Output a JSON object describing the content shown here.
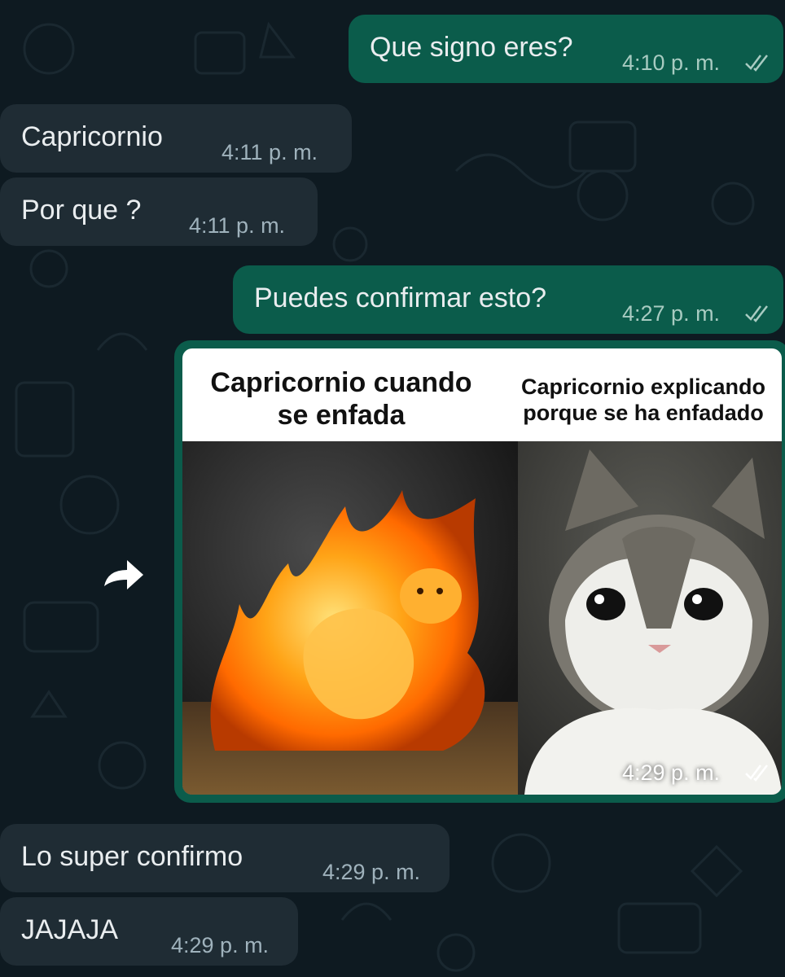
{
  "messages": [
    {
      "text": "Que signo eres?",
      "time": "4:10 p. m."
    },
    {
      "text": "Capricornio",
      "time": "4:11 p. m."
    },
    {
      "text": "Por que ?",
      "time": "4:11 p. m."
    },
    {
      "text": "Puedes confirmar esto?",
      "time": "4:27 p. m."
    },
    {
      "text": "Lo super confirmo",
      "time": "4:29 p. m."
    },
    {
      "text": "JAJAJA",
      "time": "4:29 p. m."
    }
  ],
  "image_message": {
    "caption_left": "Capricornio cuando se enfada",
    "caption_right": "Capricornio explicando porque se ha enfadado",
    "time": "4:29 p. m."
  },
  "icons": {
    "read_receipt": "double-check-icon",
    "forward": "forward-arrow-icon"
  },
  "colors": {
    "background": "#0e1a21",
    "incoming_bubble": "#1f2c34",
    "outgoing_bubble": "#0b5c4b"
  }
}
